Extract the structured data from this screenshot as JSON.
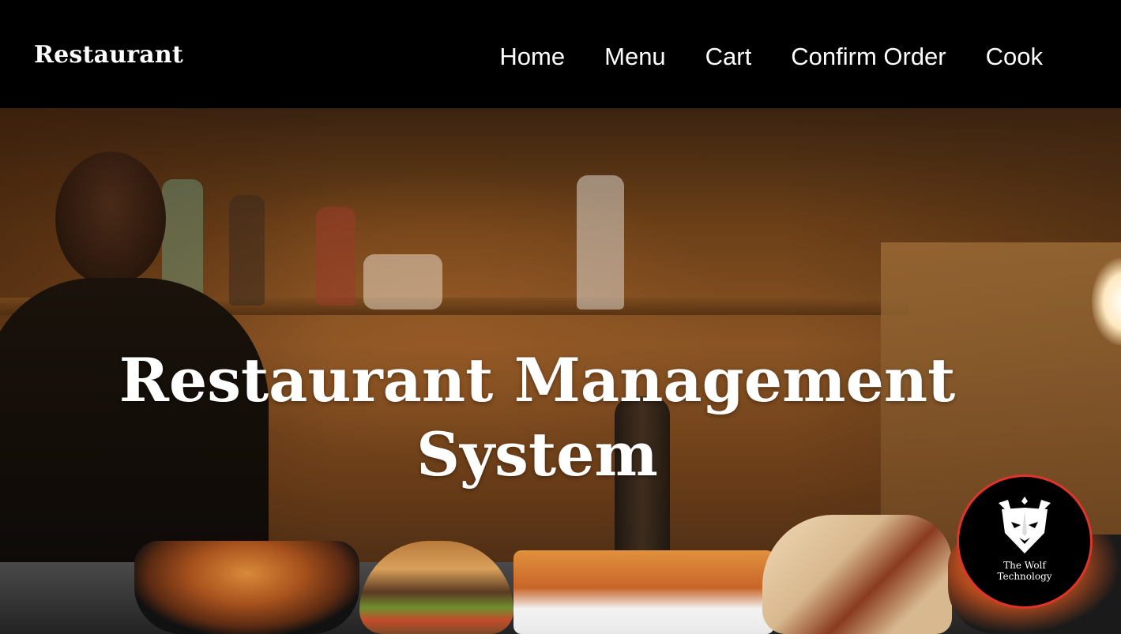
{
  "navbar": {
    "brand": "Restaurant",
    "links": [
      "Home",
      "Menu",
      "Cart",
      "Confirm Order",
      "Cook"
    ]
  },
  "hero": {
    "title_line1": "Restaurant Management",
    "title_line2": "System"
  },
  "badge": {
    "line1": "The Wolf",
    "line2": "Technology",
    "icon": "wolf-logo-icon",
    "border_color": "#e0342b"
  },
  "colors": {
    "navbar_bg": "#000000",
    "text": "#ffffff"
  }
}
